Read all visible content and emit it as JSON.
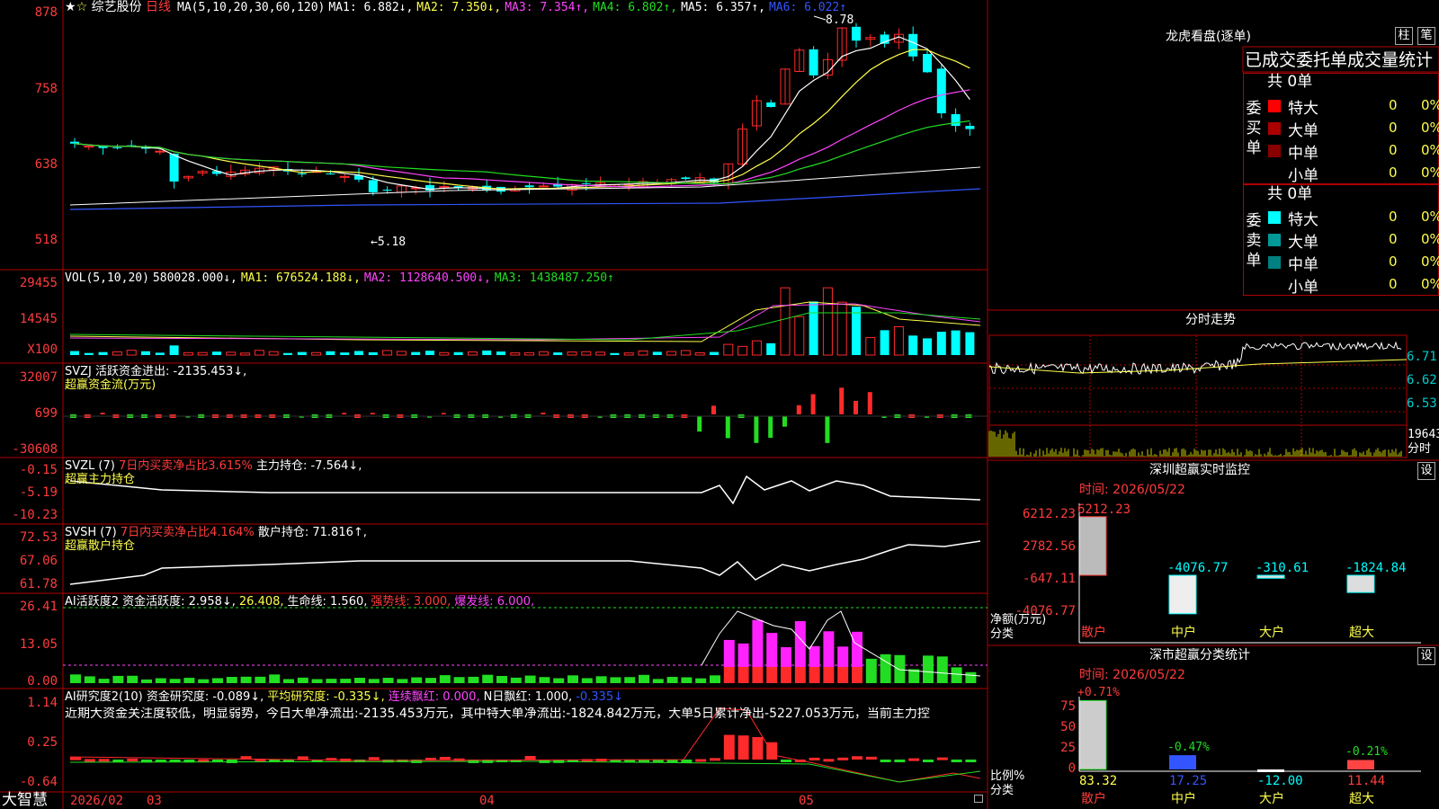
{
  "stock": {
    "stars": "★",
    "star2": "☆",
    "name": "综艺股份",
    "period": "日线"
  },
  "ma_legend": [
    {
      "label": "MA(5,10,20,30,60,120)",
      "color": "#ffffff"
    },
    {
      "label": "MA1: 6.882↓,",
      "color": "#ffffff"
    },
    {
      "label": "MA2: 7.350↓,",
      "color": "#ffff4c"
    },
    {
      "label": "MA3: 7.354↑,",
      "color": "#ff44ff"
    },
    {
      "label": "MA4: 6.802↑,",
      "color": "#22dd22"
    },
    {
      "label": "MA5: 6.357↑,",
      "color": "#ffffff"
    },
    {
      "label": "MA6: 6.022↑",
      "color": "#3355ff"
    }
  ],
  "price_axis": [
    "878",
    "758",
    "638",
    "518"
  ],
  "price_high_label": "8.78",
  "price_low_label": "←5.18",
  "vol_legend": [
    {
      "label": "VOL(5,10,20)",
      "color": "#ffffff"
    },
    {
      "label": "580028.000↓,",
      "color": "#ffffff"
    },
    {
      "label": "MA1: 676524.188↓,",
      "color": "#ffff4c"
    },
    {
      "label": "MA2: 1128640.500↓,",
      "color": "#ff44ff"
    },
    {
      "label": "MA3: 1438487.250↑",
      "color": "#22dd22"
    }
  ],
  "vol_axis": [
    "29455",
    "14545",
    "X100"
  ],
  "svzj": {
    "line1": "SVZJ  活跃资金进出: -2135.453↓,",
    "line2": "超赢资金流(万元)",
    "axis": [
      "32007",
      "699",
      "-30608"
    ]
  },
  "svzl": {
    "title": "SVZL (7)",
    "desc": "7日内买卖净占比3.615%",
    "val": "主力持仓: -7.564↓,",
    "line2": "超赢主力持仓",
    "axis": [
      "-0.15",
      "-5.19",
      "-10.23"
    ]
  },
  "svsh": {
    "title": "SVSH (7)",
    "desc": "7日内买卖净占比4.164%",
    "val": "散户持仓: 71.816↑,",
    "line2": "超赢散户持仓",
    "axis": [
      "72.53",
      "67.06",
      "61.78"
    ]
  },
  "ai_active": {
    "parts": [
      {
        "label": "AI活跃度2 资金活跃度: 2.958↓,",
        "color": "#ffffff"
      },
      {
        "label": "26.408,",
        "color": "#ffff4c"
      },
      {
        "label": "生命线: 1.560,",
        "color": "#ffffff"
      },
      {
        "label": "强势线: 3.000,",
        "color": "#ff3c3c"
      },
      {
        "label": "爆发线: 6.000,",
        "color": "#ff44ff"
      }
    ],
    "axis": [
      "26.41",
      "13.05",
      "0.00"
    ]
  },
  "ai_research": {
    "parts": [
      {
        "label": "AI研究度2(10) 资金研究度: -0.089↓,",
        "color": "#ffffff"
      },
      {
        "label": "平均研究度: -0.335↓,",
        "color": "#ffff4c"
      },
      {
        "label": "连续飘红: 0.000,",
        "color": "#ff44ff"
      },
      {
        "label": "N日飘红: 1.000,",
        "color": "#ffffff"
      },
      {
        "label": "-0.335↓",
        "color": "#3355ff"
      }
    ],
    "comment": "近期大资金关注度较低，明显弱势，今日大单净流出:-2135.453万元，其中特大单净流出:-1824.842万元，大单5日累计净出-5227.053万元，当前主力控",
    "axis": [
      "1.14",
      "0.25",
      "-0.64"
    ]
  },
  "date_axis": {
    "brand": "大智慧",
    "labels": [
      "2026/02",
      "03",
      "04",
      "05"
    ]
  },
  "longhu": {
    "title": "龙虎看盘(逐单)",
    "btn_bar": "柱",
    "btn_pen": "笔",
    "header": "已成交委托单成交量统计",
    "buy_side": "委买单",
    "sell_side": "委卖单",
    "buy_total": "共 0单",
    "sell_total": "共 0单",
    "buy_rows": [
      {
        "label": "特大",
        "color": "#ff0000",
        "count": "0",
        "pct": "0%"
      },
      {
        "label": "大单",
        "color": "#aa0000",
        "count": "0",
        "pct": "0%"
      },
      {
        "label": "中单",
        "color": "#880000",
        "count": "0",
        "pct": "0%"
      },
      {
        "label": "小单",
        "color": "",
        "count": "0",
        "pct": "0%"
      }
    ],
    "sell_rows": [
      {
        "label": "特大",
        "color": "#00ffff",
        "count": "0",
        "pct": "0%"
      },
      {
        "label": "大单",
        "color": "#009999",
        "count": "0",
        "pct": "0%"
      },
      {
        "label": "中单",
        "color": "#008080",
        "count": "0",
        "pct": "0%"
      },
      {
        "label": "小单",
        "color": "",
        "count": "0",
        "pct": "0%"
      }
    ]
  },
  "intraday": {
    "title": "分时走势",
    "axis": [
      "6.71",
      "6.62",
      "6.53"
    ],
    "vol_label": "19643",
    "vol_unit": "分时"
  },
  "sz_monitor": {
    "title": "深圳超赢实时监控",
    "btn": "设",
    "time": "时间: 2026/05/22",
    "y_axis": [
      "6212.23",
      "2782.56",
      "-647.11",
      "-4076.77"
    ],
    "y_unit": "净额(万元)",
    "x_unit": "分类",
    "bars": [
      {
        "cat": "散户",
        "value": 6212.23,
        "label": "6212.23"
      },
      {
        "cat": "中户",
        "value": -4076.77,
        "label": "-4076.77"
      },
      {
        "cat": "大户",
        "value": -310.61,
        "label": "-310.61"
      },
      {
        "cat": "超大",
        "value": -1824.84,
        "label": "-1824.84"
      }
    ]
  },
  "sz_class": {
    "title": "深市超赢分类统计",
    "btn": "设",
    "time": "时间: 2026/05/22",
    "y_axis": [
      "75",
      "50",
      "25",
      "0"
    ],
    "y_unit": "比例%",
    "x_unit": "分类",
    "bars": [
      {
        "cat": "散户",
        "pct": 83.32,
        "label": "83.32",
        "delta": "+0.71%"
      },
      {
        "cat": "中户",
        "pct": 17.25,
        "label": "17.25",
        "delta": "-0.47%"
      },
      {
        "cat": "大户",
        "pct": -12.0,
        "label": "-12.00",
        "delta": ""
      },
      {
        "cat": "超大",
        "pct": 11.44,
        "label": "11.44",
        "delta": "-0.21%"
      }
    ]
  }
}
